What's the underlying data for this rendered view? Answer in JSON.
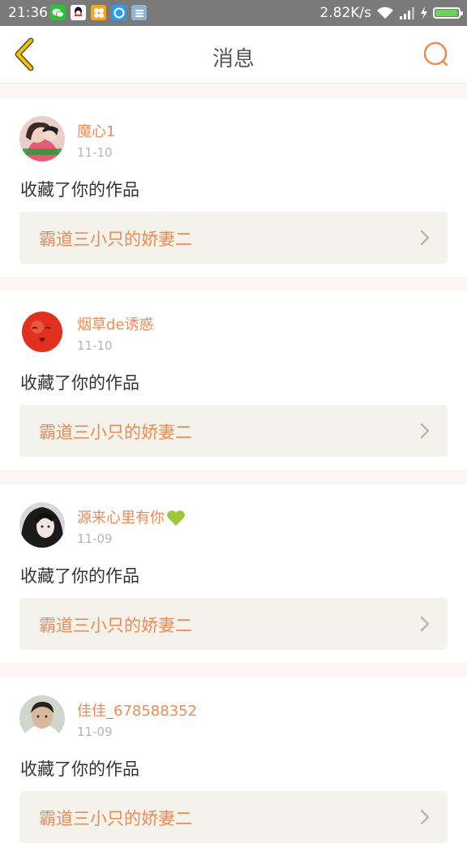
{
  "status_bar": {
    "time": "21:36",
    "speed": "2.82K/s",
    "app_icons": [
      "wechat-icon",
      "qq-icon",
      "kuaikan-icon",
      "browser-icon",
      "notes-icon"
    ],
    "battery_level": 0.95
  },
  "header": {
    "title": "消息",
    "accent_color": "#ee8a56",
    "back_color": "#e7b400"
  },
  "messages": [
    {
      "name": "魔心1",
      "date": "11-10",
      "action": "收藏了你的作品",
      "work": "霸道三小只的娇妻二"
    },
    {
      "name": "烟草de诱惑",
      "date": "11-10",
      "action": "收藏了你的作品",
      "work": "霸道三小只的娇妻二"
    },
    {
      "name": "源来心里有你",
      "date": "11-09",
      "action": "收藏了你的作品",
      "work": "霸道三小只的娇妻二",
      "badge": "green-heart-icon"
    },
    {
      "name": "佳佳_678588352",
      "date": "11-09",
      "action": "收藏了你的作品",
      "work": "霸道三小只的娇妻二"
    }
  ]
}
